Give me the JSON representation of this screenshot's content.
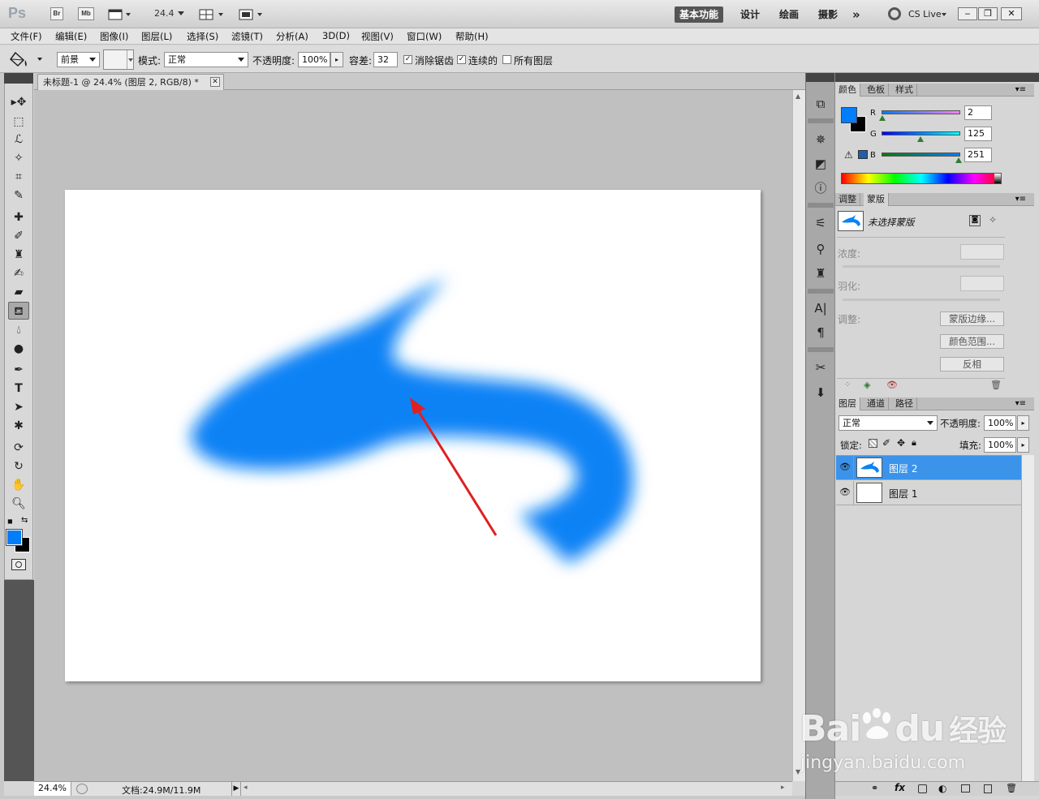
{
  "app": {
    "logo": "Ps",
    "bridge_btn": "Br",
    "minibridge_btn": "Mb",
    "zoom": "24.4",
    "workspaces": [
      "基本功能",
      "设计",
      "绘画",
      "摄影"
    ],
    "more": "»",
    "cs_live": "CS Live"
  },
  "menu": [
    "文件(F)",
    "编辑(E)",
    "图像(I)",
    "图层(L)",
    "选择(S)",
    "滤镜(T)",
    "分析(A)",
    "3D(D)",
    "视图(V)",
    "窗口(W)",
    "帮助(H)"
  ],
  "options": {
    "fill_source": "前景",
    "mode_label": "模式:",
    "mode_value": "正常",
    "opacity_label": "不透明度:",
    "opacity_value": "100%",
    "tolerance_label": "容差:",
    "tolerance_value": "32",
    "antialias_label": "消除锯齿",
    "contiguous_label": "连续的",
    "all_layers_label": "所有图层",
    "antialias_checked": true,
    "contiguous_checked": true,
    "all_layers_checked": false
  },
  "document": {
    "tab_title": "未标题-1 @ 24.4% (图层 2, RGB/8) *",
    "status_zoom": "24.4%",
    "status_doc": "文档:24.9M/11.9M"
  },
  "colors": {
    "foreground": "#027dfb",
    "background": "#000000",
    "shape_fill": "#0a82f5",
    "arrow": "#e02020",
    "selection": "#3b93ea"
  },
  "color_panel": {
    "tabs": [
      "颜色",
      "色板",
      "样式"
    ],
    "r_label": "R",
    "g_label": "G",
    "b_label": "B",
    "r": "2",
    "g": "125",
    "b": "251"
  },
  "mask_panel": {
    "tabs": [
      "调整",
      "蒙版"
    ],
    "title": "未选择蒙版",
    "density_label": "浓度:",
    "feather_label": "羽化:",
    "refine_label": "调整:",
    "btn_mask_edge": "蒙版边缘...",
    "btn_color_range": "颜色范围...",
    "btn_invert": "反相"
  },
  "layers_panel": {
    "tabs": [
      "图层",
      "通道",
      "路径"
    ],
    "blend_mode": "正常",
    "opacity_label": "不透明度:",
    "opacity_value": "100%",
    "lock_label": "锁定:",
    "fill_label": "填充:",
    "fill_value": "100%",
    "layers": [
      {
        "name": "图层 2",
        "selected": true
      },
      {
        "name": "图层 1",
        "selected": false
      }
    ]
  },
  "watermark": {
    "brand": "Bai",
    "brand2": "du",
    "suffix": "经验",
    "url": "jingyan.baidu.com"
  }
}
